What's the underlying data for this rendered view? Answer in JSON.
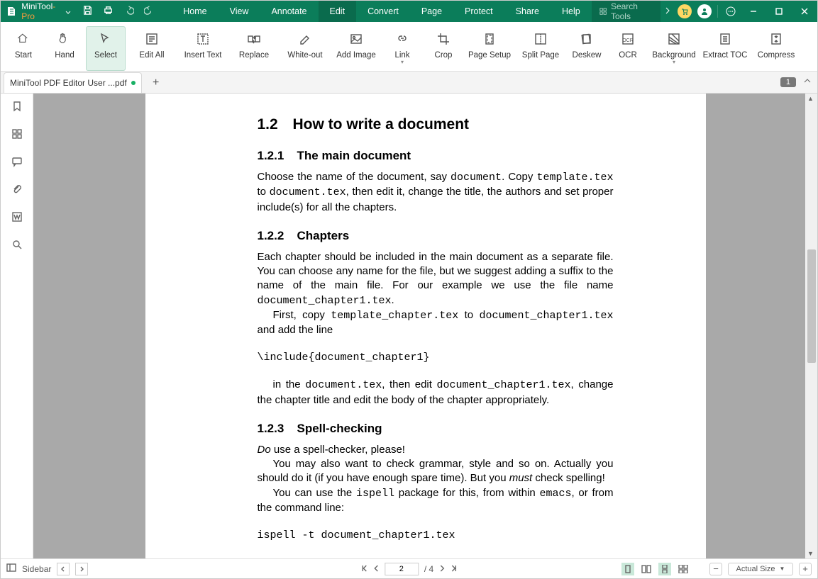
{
  "app": {
    "name_a": "MiniTool",
    "name_b": "-Pro"
  },
  "menu": [
    "Home",
    "View",
    "Annotate",
    "Edit",
    "Convert",
    "Page",
    "Protect",
    "Share",
    "Help"
  ],
  "menu_active": 3,
  "search_tools": "Search Tools",
  "ribbon": [
    {
      "label": "Start",
      "dd": false
    },
    {
      "label": "Hand",
      "dd": false
    },
    {
      "label": "Select",
      "dd": false,
      "active": true
    },
    {
      "label": "Edit All",
      "dd": false
    },
    {
      "label": "Insert Text",
      "dd": false
    },
    {
      "label": "Replace",
      "dd": false
    },
    {
      "label": "White-out",
      "dd": false
    },
    {
      "label": "Add Image",
      "dd": false
    },
    {
      "label": "Link",
      "dd": true
    },
    {
      "label": "Crop",
      "dd": false
    },
    {
      "label": "Page Setup",
      "dd": false
    },
    {
      "label": "Split Page",
      "dd": false
    },
    {
      "label": "Deskew",
      "dd": false
    },
    {
      "label": "OCR",
      "dd": false
    },
    {
      "label": "Background",
      "dd": true
    },
    {
      "label": "Extract TOC",
      "dd": false
    },
    {
      "label": "Compress",
      "dd": false
    }
  ],
  "tab": {
    "title": "MiniTool PDF Editor User ...pdf"
  },
  "page_badge": "1",
  "document": {
    "h12_num": "1.2",
    "h12": "How to write a document",
    "h121_num": "1.2.1",
    "h121": "The main document",
    "p121a": "Choose the name of the document, say ",
    "p121a_c1": "document",
    "p121a_2": ". Copy ",
    "p121a_c2": "template.tex",
    "p121a_3": " to ",
    "p121a_c3": "document.tex",
    "p121a_4": ", then edit it, change the title, the authors and set proper include(s) for all the chapters.",
    "h122_num": "1.2.2",
    "h122": "Chapters",
    "p122a": "Each chapter should be included in the main document as a separate file. You can choose any name for the file, but we suggest adding a suffix to the name of the main file. For our example we use the file name ",
    "p122a_c1": "document_chapter1.tex",
    "p122a_2": ".",
    "p122b_1": "First, copy ",
    "p122b_c1": "template_chapter.tex",
    "p122b_2": " to ",
    "p122b_c2": "document_chapter1.tex",
    "p122b_3": " and add the line",
    "code1": "\\include{document_chapter1}",
    "p122c_1": "in the ",
    "p122c_c1": "document.tex",
    "p122c_2": ", then edit ",
    "p122c_c2": "document_chapter1.tex",
    "p122c_3": ", change the chapter title and edit the body of the chapter appropriately.",
    "h123_num": "1.2.3",
    "h123": "Spell-checking",
    "p123a_em": "Do",
    "p123a": " use a spell-checker, please!",
    "p123b": "You may also want to check grammar, style and so on. Actually you should do it (if you have enough spare time). But you ",
    "p123b_em": "must",
    "p123b_2": " check spelling!",
    "p123c_1": "You can use the ",
    "p123c_c1": "ispell",
    "p123c_2": " package for this, from within ",
    "p123c_c2": "emacs",
    "p123c_3": ", or from the command line:",
    "code2": "ispell -t document_chapter1.tex"
  },
  "status": {
    "sidebar": "Sidebar",
    "page_current": "2",
    "page_total": "/ 4",
    "zoom_label": "Actual Size"
  }
}
